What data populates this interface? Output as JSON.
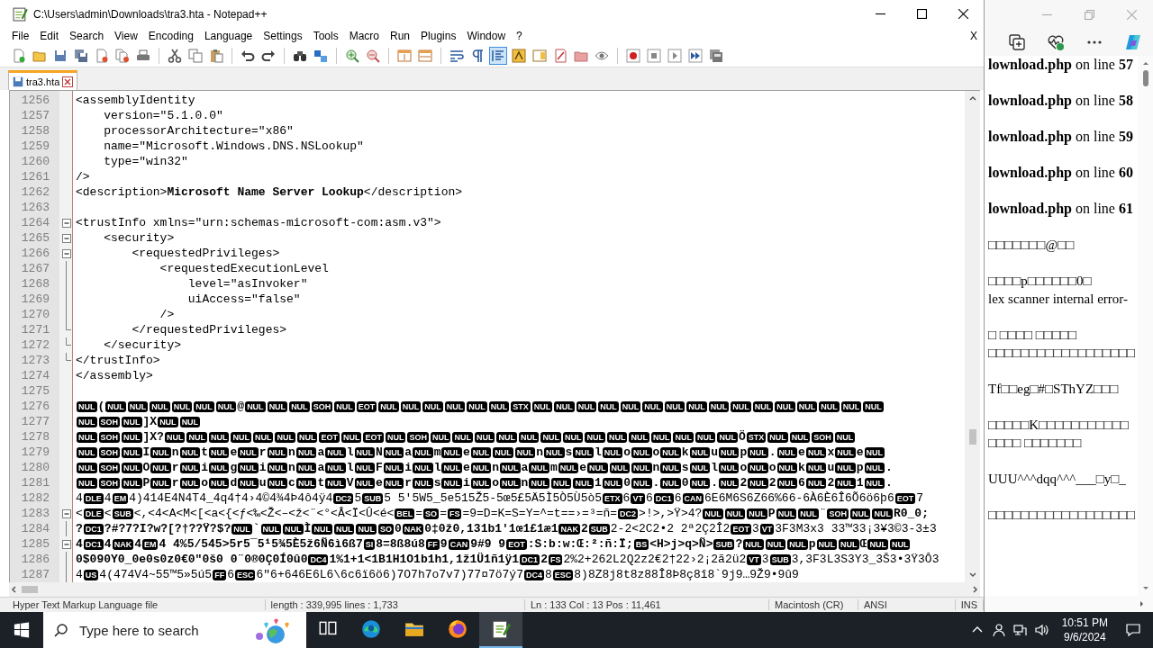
{
  "window": {
    "title": "C:\\Users\\admin\\Downloads\\tra3.hta - Notepad++"
  },
  "menu": [
    "File",
    "Edit",
    "Search",
    "View",
    "Encoding",
    "Language",
    "Settings",
    "Tools",
    "Macro",
    "Run",
    "Plugins",
    "Window",
    "?"
  ],
  "close_document": "X",
  "toolbar": [
    {
      "on": false
    },
    {
      "on": false
    },
    {
      "on": false
    },
    {
      "on": false
    },
    {
      "on": false
    },
    {
      "on": false
    },
    {
      "on": false
    },
    {
      "on": false
    },
    {
      "on": false
    },
    {
      "on": false
    },
    {
      "on": false
    },
    {
      "on": false
    },
    {
      "on": false
    },
    {
      "on": false
    },
    {
      "on": false
    },
    {
      "on": false
    },
    {
      "on": false
    },
    {
      "on": false
    },
    {
      "on": false
    },
    {
      "on": false
    },
    {
      "on": true
    },
    {
      "on": false
    },
    {
      "on": false
    },
    {
      "on": false
    },
    {
      "on": false
    },
    {
      "on": false
    },
    {
      "on": false
    },
    {
      "on": false
    },
    {
      "on": false
    },
    {
      "on": false
    },
    {
      "on": false
    }
  ],
  "tabs": [
    {
      "label": "tra3.hta",
      "selected": true
    }
  ],
  "editor": {
    "lines": [
      {
        "number": "1256",
        "segments": [
          {
            "kind": "plain",
            "text": "<assemblyIdentity"
          }
        ]
      },
      {
        "number": "1257",
        "segments": [
          {
            "kind": "plain",
            "text": "    version=\"5.1.0.0\""
          }
        ]
      },
      {
        "number": "1258",
        "segments": [
          {
            "kind": "plain",
            "text": "    processorArchitecture=\"x86\""
          }
        ]
      },
      {
        "number": "1259",
        "segments": [
          {
            "kind": "plain",
            "text": "    name=\"Microsoft.Windows.DNS.NSLookup\""
          }
        ]
      },
      {
        "number": "1260",
        "segments": [
          {
            "kind": "plain",
            "text": "    type=\"win32\""
          }
        ]
      },
      {
        "number": "1261",
        "segments": [
          {
            "kind": "plain",
            "text": "/>"
          }
        ]
      },
      {
        "number": "1262",
        "segments": [
          {
            "kind": "plain",
            "text": "<description>"
          },
          {
            "kind": "bold",
            "text": "Microsoft Name Server Lookup"
          },
          {
            "kind": "plain",
            "text": "</description>"
          }
        ]
      },
      {
        "number": "1263"
      },
      {
        "number": "1264",
        "kind": "foldstart",
        "segments": [
          {
            "kind": "plain",
            "text": "<trustInfo xmlns=\"urn:schemas-microsoft-com:asm.v3\">"
          }
        ]
      },
      {
        "number": "1265",
        "kind": "foldstart",
        "segments": [
          {
            "kind": "plain",
            "text": "    <security>"
          }
        ]
      },
      {
        "number": "1266",
        "kind": "foldstart",
        "segments": [
          {
            "kind": "plain",
            "text": "        <requestedPrivileges>"
          }
        ]
      },
      {
        "number": "1267",
        "kind": "foldline",
        "segments": [
          {
            "kind": "plain",
            "text": "            <requestedExecutionLevel"
          }
        ]
      },
      {
        "number": "1268",
        "kind": "foldline",
        "segments": [
          {
            "kind": "plain",
            "text": "                level=\"asInvoker\""
          }
        ]
      },
      {
        "number": "1269",
        "kind": "foldline",
        "segments": [
          {
            "kind": "plain",
            "text": "                uiAccess=\"false\""
          }
        ]
      },
      {
        "number": "1270",
        "kind": "foldline",
        "segments": [
          {
            "kind": "plain",
            "text": "            />"
          }
        ]
      },
      {
        "number": "1271",
        "kind": "foldend",
        "segments": [
          {
            "kind": "plain",
            "text": "        </requestedPrivileges>"
          }
        ]
      },
      {
        "number": "1272",
        "kind": "foldend",
        "segments": [
          {
            "kind": "plain",
            "text": "    </security>"
          }
        ]
      },
      {
        "number": "1273",
        "kind": "foldend",
        "segments": [
          {
            "kind": "plain",
            "text": "</trustInfo>"
          }
        ]
      },
      {
        "number": "1274",
        "segments": [
          {
            "kind": "plain",
            "text": "</assembly>"
          }
        ]
      },
      {
        "number": "1275"
      },
      {
        "number": "1276",
        "segments": [
          {
            "kind": "ctrl",
            "text": "NUL"
          },
          {
            "kind": "bold",
            "text": "("
          },
          {
            "kind": "ctrl",
            "text": "NUL"
          },
          {
            "kind": "ctrl",
            "text": "NUL"
          },
          {
            "kind": "ctrl",
            "text": "NUL"
          },
          {
            "kind": "ctrl",
            "text": "NUL"
          },
          {
            "kind": "ctrl",
            "text": "NUL"
          },
          {
            "kind": "ctrl",
            "text": "NUL"
          },
          {
            "kind": "bold",
            "text": "@"
          },
          {
            "kind": "ctrl",
            "text": "NUL"
          },
          {
            "kind": "ctrl",
            "text": "NUL"
          },
          {
            "kind": "ctrl",
            "text": "NUL"
          },
          {
            "kind": "ctrl",
            "text": "SOH"
          },
          {
            "kind": "ctrl",
            "text": "NUL"
          },
          {
            "kind": "ctrl",
            "text": "EOT"
          },
          {
            "kind": "ctrl",
            "text": "NUL"
          },
          {
            "kind": "ctrl",
            "text": "NUL"
          },
          {
            "kind": "ctrl",
            "text": "NUL"
          },
          {
            "kind": "ctrl",
            "text": "NUL"
          },
          {
            "kind": "ctrl",
            "text": "NUL"
          },
          {
            "kind": "ctrl",
            "text": "NUL"
          },
          {
            "kind": "ctrl",
            "text": "STX"
          },
          {
            "kind": "ctrl",
            "text": "NUL"
          },
          {
            "kind": "ctrl",
            "text": "NUL"
          },
          {
            "kind": "ctrl",
            "text": "NUL"
          },
          {
            "kind": "ctrl",
            "text": "NUL"
          },
          {
            "kind": "ctrl",
            "text": "NUL"
          },
          {
            "kind": "ctrl",
            "text": "NUL"
          },
          {
            "kind": "ctrl",
            "text": "NUL"
          },
          {
            "kind": "ctrl",
            "text": "NUL"
          },
          {
            "kind": "ctrl",
            "text": "NUL"
          },
          {
            "kind": "ctrl",
            "text": "NUL"
          },
          {
            "kind": "ctrl",
            "text": "NUL"
          },
          {
            "kind": "ctrl",
            "text": "NUL"
          },
          {
            "kind": "ctrl",
            "text": "NUL"
          },
          {
            "kind": "ctrl",
            "text": "NUL"
          },
          {
            "kind": "ctrl",
            "text": "NUL"
          },
          {
            "kind": "ctrl",
            "text": "NUL"
          }
        ]
      },
      {
        "number": "1277",
        "segments": [
          {
            "kind": "ctrl",
            "text": "NUL"
          },
          {
            "kind": "ctrl",
            "text": "SOH"
          },
          {
            "kind": "ctrl",
            "text": "NUL"
          },
          {
            "kind": "bold",
            "text": "]X"
          },
          {
            "kind": "ctrl",
            "text": "NUL"
          },
          {
            "kind": "ctrl",
            "text": "NUL"
          }
        ]
      },
      {
        "number": "1278",
        "segments": [
          {
            "kind": "ctrl",
            "text": "NUL"
          },
          {
            "kind": "ctrl",
            "text": "SOH"
          },
          {
            "kind": "ctrl",
            "text": "NUL"
          },
          {
            "kind": "bold",
            "text": "]X?"
          },
          {
            "kind": "ctrl",
            "text": "NUL"
          },
          {
            "kind": "ctrl",
            "text": "NUL"
          },
          {
            "kind": "ctrl",
            "text": "NUL"
          },
          {
            "kind": "ctrl",
            "text": "NUL"
          },
          {
            "kind": "ctrl",
            "text": "NUL"
          },
          {
            "kind": "ctrl",
            "text": "NUL"
          },
          {
            "kind": "ctrl",
            "text": "NUL"
          },
          {
            "kind": "ctrl",
            "text": "EOT"
          },
          {
            "kind": "ctrl",
            "text": "NUL"
          },
          {
            "kind": "ctrl",
            "text": "EOT"
          },
          {
            "kind": "ctrl",
            "text": "NUL"
          },
          {
            "kind": "ctrl",
            "text": "SOH"
          },
          {
            "kind": "ctrl",
            "text": "NUL"
          },
          {
            "kind": "ctrl",
            "text": "NUL"
          },
          {
            "kind": "ctrl",
            "text": "NUL"
          },
          {
            "kind": "ctrl",
            "text": "NUL"
          },
          {
            "kind": "ctrl",
            "text": "NUL"
          },
          {
            "kind": "ctrl",
            "text": "NUL"
          },
          {
            "kind": "ctrl",
            "text": "NUL"
          },
          {
            "kind": "ctrl",
            "text": "NUL"
          },
          {
            "kind": "ctrl",
            "text": "NUL"
          },
          {
            "kind": "ctrl",
            "text": "NUL"
          },
          {
            "kind": "ctrl",
            "text": "NUL"
          },
          {
            "kind": "ctrl",
            "text": "NUL"
          },
          {
            "kind": "ctrl",
            "text": "NUL"
          },
          {
            "kind": "ctrl",
            "text": "NUL"
          },
          {
            "kind": "bold",
            "text": "Ö"
          },
          {
            "kind": "ctrl",
            "text": "STX"
          },
          {
            "kind": "ctrl",
            "text": "NUL"
          },
          {
            "kind": "ctrl",
            "text": "NUL"
          },
          {
            "kind": "ctrl",
            "text": "SOH"
          },
          {
            "kind": "ctrl",
            "text": "NUL"
          }
        ]
      },
      {
        "number": "1279",
        "segments": [
          {
            "kind": "ctrl",
            "text": "NUL"
          },
          {
            "kind": "ctrl",
            "text": "SOH"
          },
          {
            "kind": "ctrl",
            "text": "NUL"
          },
          {
            "kind": "bold",
            "text": "I"
          },
          {
            "kind": "ctrl",
            "text": "NUL"
          },
          {
            "kind": "bold",
            "text": "n"
          },
          {
            "kind": "ctrl",
            "text": "NUL"
          },
          {
            "kind": "bold",
            "text": "t"
          },
          {
            "kind": "ctrl",
            "text": "NUL"
          },
          {
            "kind": "bold",
            "text": "e"
          },
          {
            "kind": "ctrl",
            "text": "NUL"
          },
          {
            "kind": "bold",
            "text": "r"
          },
          {
            "kind": "ctrl",
            "text": "NUL"
          },
          {
            "kind": "bold",
            "text": "n"
          },
          {
            "kind": "ctrl",
            "text": "NUL"
          },
          {
            "kind": "bold",
            "text": "a"
          },
          {
            "kind": "ctrl",
            "text": "NUL"
          },
          {
            "kind": "bold",
            "text": "l"
          },
          {
            "kind": "ctrl",
            "text": "NUL"
          },
          {
            "kind": "bold",
            "text": "N"
          },
          {
            "kind": "ctrl",
            "text": "NUL"
          },
          {
            "kind": "bold",
            "text": "a"
          },
          {
            "kind": "ctrl",
            "text": "NUL"
          },
          {
            "kind": "bold",
            "text": "m"
          },
          {
            "kind": "ctrl",
            "text": "NUL"
          },
          {
            "kind": "bold",
            "text": "e"
          },
          {
            "kind": "ctrl",
            "text": "NUL"
          },
          {
            "kind": "ctrl",
            "text": "NUL"
          },
          {
            "kind": "ctrl",
            "text": "NUL"
          },
          {
            "kind": "bold",
            "text": "n"
          },
          {
            "kind": "ctrl",
            "text": "NUL"
          },
          {
            "kind": "bold",
            "text": "s"
          },
          {
            "kind": "ctrl",
            "text": "NUL"
          },
          {
            "kind": "bold",
            "text": "l"
          },
          {
            "kind": "ctrl",
            "text": "NUL"
          },
          {
            "kind": "bold",
            "text": "o"
          },
          {
            "kind": "ctrl",
            "text": "NUL"
          },
          {
            "kind": "bold",
            "text": "o"
          },
          {
            "kind": "ctrl",
            "text": "NUL"
          },
          {
            "kind": "bold",
            "text": "k"
          },
          {
            "kind": "ctrl",
            "text": "NUL"
          },
          {
            "kind": "bold",
            "text": "u"
          },
          {
            "kind": "ctrl",
            "text": "NUL"
          },
          {
            "kind": "bold",
            "text": "p"
          },
          {
            "kind": "ctrl",
            "text": "NUL"
          },
          {
            "kind": "bold",
            "text": "."
          },
          {
            "kind": "ctrl",
            "text": "NUL"
          },
          {
            "kind": "bold",
            "text": "e"
          },
          {
            "kind": "ctrl",
            "text": "NUL"
          },
          {
            "kind": "bold",
            "text": "x"
          },
          {
            "kind": "ctrl",
            "text": "NUL"
          },
          {
            "kind": "bold",
            "text": "e"
          },
          {
            "kind": "ctrl",
            "text": "NUL"
          }
        ]
      },
      {
        "number": "1280",
        "segments": [
          {
            "kind": "ctrl",
            "text": "NUL"
          },
          {
            "kind": "ctrl",
            "text": "SOH"
          },
          {
            "kind": "ctrl",
            "text": "NUL"
          },
          {
            "kind": "bold",
            "text": "O"
          },
          {
            "kind": "ctrl",
            "text": "NUL"
          },
          {
            "kind": "bold",
            "text": "r"
          },
          {
            "kind": "ctrl",
            "text": "NUL"
          },
          {
            "kind": "bold",
            "text": "i"
          },
          {
            "kind": "ctrl",
            "text": "NUL"
          },
          {
            "kind": "bold",
            "text": "g"
          },
          {
            "kind": "ctrl",
            "text": "NUL"
          },
          {
            "kind": "bold",
            "text": "i"
          },
          {
            "kind": "ctrl",
            "text": "NUL"
          },
          {
            "kind": "bold",
            "text": "n"
          },
          {
            "kind": "ctrl",
            "text": "NUL"
          },
          {
            "kind": "bold",
            "text": "a"
          },
          {
            "kind": "ctrl",
            "text": "NUL"
          },
          {
            "kind": "bold",
            "text": "l"
          },
          {
            "kind": "ctrl",
            "text": "NUL"
          },
          {
            "kind": "bold",
            "text": "F"
          },
          {
            "kind": "ctrl",
            "text": "NUL"
          },
          {
            "kind": "bold",
            "text": "i"
          },
          {
            "kind": "ctrl",
            "text": "NUL"
          },
          {
            "kind": "bold",
            "text": "l"
          },
          {
            "kind": "ctrl",
            "text": "NUL"
          },
          {
            "kind": "bold",
            "text": "e"
          },
          {
            "kind": "ctrl",
            "text": "NUL"
          },
          {
            "kind": "bold",
            "text": "n"
          },
          {
            "kind": "ctrl",
            "text": "NUL"
          },
          {
            "kind": "bold",
            "text": "a"
          },
          {
            "kind": "ctrl",
            "text": "NUL"
          },
          {
            "kind": "bold",
            "text": "m"
          },
          {
            "kind": "ctrl",
            "text": "NUL"
          },
          {
            "kind": "bold",
            "text": "e"
          },
          {
            "kind": "ctrl",
            "text": "NUL"
          },
          {
            "kind": "ctrl",
            "text": "NUL"
          },
          {
            "kind": "ctrl",
            "text": "NUL"
          },
          {
            "kind": "bold",
            "text": "n"
          },
          {
            "kind": "ctrl",
            "text": "NUL"
          },
          {
            "kind": "bold",
            "text": "s"
          },
          {
            "kind": "ctrl",
            "text": "NUL"
          },
          {
            "kind": "bold",
            "text": "l"
          },
          {
            "kind": "ctrl",
            "text": "NUL"
          },
          {
            "kind": "bold",
            "text": "o"
          },
          {
            "kind": "ctrl",
            "text": "NUL"
          },
          {
            "kind": "bold",
            "text": "o"
          },
          {
            "kind": "ctrl",
            "text": "NUL"
          },
          {
            "kind": "bold",
            "text": "k"
          },
          {
            "kind": "ctrl",
            "text": "NUL"
          },
          {
            "kind": "bold",
            "text": "u"
          },
          {
            "kind": "ctrl",
            "text": "NUL"
          },
          {
            "kind": "bold",
            "text": "p"
          },
          {
            "kind": "ctrl",
            "text": "NUL"
          },
          {
            "kind": "bold",
            "text": "."
          }
        ]
      },
      {
        "number": "1281",
        "segments": [
          {
            "kind": "ctrl",
            "text": "NUL"
          },
          {
            "kind": "ctrl",
            "text": "SOH"
          },
          {
            "kind": "ctrl",
            "text": "NUL"
          },
          {
            "kind": "bold",
            "text": "P"
          },
          {
            "kind": "ctrl",
            "text": "NUL"
          },
          {
            "kind": "bold",
            "text": "r"
          },
          {
            "kind": "ctrl",
            "text": "NUL"
          },
          {
            "kind": "bold",
            "text": "o"
          },
          {
            "kind": "ctrl",
            "text": "NUL"
          },
          {
            "kind": "bold",
            "text": "d"
          },
          {
            "kind": "ctrl",
            "text": "NUL"
          },
          {
            "kind": "bold",
            "text": "u"
          },
          {
            "kind": "ctrl",
            "text": "NUL"
          },
          {
            "kind": "bold",
            "text": "c"
          },
          {
            "kind": "ctrl",
            "text": "NUL"
          },
          {
            "kind": "bold",
            "text": "t"
          },
          {
            "kind": "ctrl",
            "text": "NUL"
          },
          {
            "kind": "bold",
            "text": "V"
          },
          {
            "kind": "ctrl",
            "text": "NUL"
          },
          {
            "kind": "bold",
            "text": "e"
          },
          {
            "kind": "ctrl",
            "text": "NUL"
          },
          {
            "kind": "bold",
            "text": "r"
          },
          {
            "kind": "ctrl",
            "text": "NUL"
          },
          {
            "kind": "bold",
            "text": "s"
          },
          {
            "kind": "ctrl",
            "text": "NUL"
          },
          {
            "kind": "bold",
            "text": "i"
          },
          {
            "kind": "ctrl",
            "text": "NUL"
          },
          {
            "kind": "bold",
            "text": "o"
          },
          {
            "kind": "ctrl",
            "text": "NUL"
          },
          {
            "kind": "bold",
            "text": "n"
          },
          {
            "kind": "ctrl",
            "text": "NUL"
          },
          {
            "kind": "ctrl",
            "text": "NUL"
          },
          {
            "kind": "ctrl",
            "text": "NUL"
          },
          {
            "kind": "bold",
            "text": "1"
          },
          {
            "kind": "ctrl",
            "text": "NUL"
          },
          {
            "kind": "bold",
            "text": "0"
          },
          {
            "kind": "ctrl",
            "text": "NUL"
          },
          {
            "kind": "bold",
            "text": "."
          },
          {
            "kind": "ctrl",
            "text": "NUL"
          },
          {
            "kind": "bold",
            "text": "0"
          },
          {
            "kind": "ctrl",
            "text": "NUL"
          },
          {
            "kind": "bold",
            "text": "."
          },
          {
            "kind": "ctrl",
            "text": "NUL"
          },
          {
            "kind": "bold",
            "text": "2"
          },
          {
            "kind": "ctrl",
            "text": "NUL"
          },
          {
            "kind": "bold",
            "text": "2"
          },
          {
            "kind": "ctrl",
            "text": "NUL"
          },
          {
            "kind": "bold",
            "text": "6"
          },
          {
            "kind": "ctrl",
            "text": "NUL"
          },
          {
            "kind": "bold",
            "text": "2"
          },
          {
            "kind": "ctrl",
            "text": "NUL"
          },
          {
            "kind": "bold",
            "text": "1"
          },
          {
            "kind": "ctrl",
            "text": "NUL"
          },
          {
            "kind": "bold",
            "text": "."
          }
        ]
      },
      {
        "number": "1282",
        "segments": [
          {
            "kind": "plain",
            "text": "4"
          },
          {
            "kind": "ctrl",
            "text": "DLE"
          },
          {
            "kind": "plain",
            "text": "4"
          },
          {
            "kind": "ctrl",
            "text": "EM"
          },
          {
            "kind": "plain",
            "text": "4)414E4N4T4_4q4†4›4©4¾4Þ4ô4ÿ4"
          },
          {
            "kind": "ctrl",
            "text": "DC2"
          },
          {
            "kind": "plain",
            "text": "5"
          },
          {
            "kind": "ctrl",
            "text": "SUB"
          },
          {
            "kind": "plain",
            "text": "5 5'5W5_5e515Ž5-5œ5£5Ä5Ì5Ò5Ù5ò5"
          },
          {
            "kind": "ctrl",
            "text": "ETX"
          },
          {
            "kind": "plain",
            "text": "6"
          },
          {
            "kind": "ctrl",
            "text": "VT"
          },
          {
            "kind": "plain",
            "text": "6"
          },
          {
            "kind": "ctrl",
            "text": "DC1"
          },
          {
            "kind": "plain",
            "text": "6"
          },
          {
            "kind": "ctrl",
            "text": "CAN"
          },
          {
            "kind": "plain",
            "text": "6E6M6S6Z66%66-6À6È6Î6Õ6ö6þ6"
          },
          {
            "kind": "ctrl",
            "text": "EOT"
          },
          {
            "kind": "plain",
            "text": "7"
          }
        ]
      },
      {
        "number": "1283",
        "kind": "foldstart",
        "segments": [
          {
            "kind": "plain",
            "text": "<"
          },
          {
            "kind": "ctrl",
            "text": "DLE"
          },
          {
            "kind": "plain",
            "text": "<"
          },
          {
            "kind": "ctrl",
            "text": "SUB"
          },
          {
            "kind": "plain",
            "text": "<,<4<A<M<[<a<{<ƒ<‰<Ž<–<ž<¨<°<Â<Ï<Û<é<"
          },
          {
            "kind": "ctrl",
            "text": "BEL"
          },
          {
            "kind": "plain",
            "text": "="
          },
          {
            "kind": "ctrl",
            "text": "SO"
          },
          {
            "kind": "plain",
            "text": "="
          },
          {
            "kind": "ctrl",
            "text": "FS"
          },
          {
            "kind": "plain",
            "text": "=9=D=K=S=Y=^=t==›=³=ñ="
          },
          {
            "kind": "ctrl",
            "text": "DC2"
          },
          {
            "kind": "plain",
            "text": ">!>,>Ÿ>4?"
          },
          {
            "kind": "ctrl",
            "text": "NUL"
          },
          {
            "kind": "ctrl",
            "text": "NUL"
          },
          {
            "kind": "ctrl",
            "text": "NUL"
          },
          {
            "kind": "bold",
            "text": "P"
          },
          {
            "kind": "ctrl",
            "text": "NUL"
          },
          {
            "kind": "ctrl",
            "text": "NUL"
          },
          {
            "kind": "plain",
            "text": "¨"
          },
          {
            "kind": "ctrl",
            "text": "SOH"
          },
          {
            "kind": "ctrl",
            "text": "NUL"
          },
          {
            "kind": "ctrl",
            "text": "NUL"
          },
          {
            "kind": "bold",
            "text": "R0_0;"
          }
        ]
      },
      {
        "number": "1284",
        "kind": "foldline",
        "segments": [
          {
            "kind": "bold",
            "text": "?"
          },
          {
            "kind": "ctrl",
            "text": "DC1"
          },
          {
            "kind": "bold",
            "text": "?#?7?I?w?[?†??Ÿ?$?"
          },
          {
            "kind": "ctrl",
            "text": "NUL"
          },
          {
            "kind": "bold",
            "text": "`"
          },
          {
            "kind": "ctrl",
            "text": "NUL"
          },
          {
            "kind": "ctrl",
            "text": "NUL"
          },
          {
            "kind": "bold",
            "text": "Ì"
          },
          {
            "kind": "ctrl",
            "text": "NUL"
          },
          {
            "kind": "ctrl",
            "text": "NUL"
          },
          {
            "kind": "ctrl",
            "text": "NUL"
          },
          {
            "kind": "ctrl",
            "text": "SO"
          },
          {
            "kind": "bold",
            "text": "0"
          },
          {
            "kind": "ctrl",
            "text": "NAK"
          },
          {
            "kind": "bold",
            "text": "0‡0ž0,131b1'1œ1£1æ1"
          },
          {
            "kind": "ctrl",
            "text": "NAK"
          },
          {
            "kind": "bold",
            "text": "2"
          },
          {
            "kind": "ctrl",
            "text": "SUB"
          },
          {
            "kind": "plain",
            "text": "2-2<2C2•2 2ª2Ç2Î2"
          },
          {
            "kind": "ctrl",
            "text": "EOT"
          },
          {
            "kind": "plain",
            "text": "3"
          },
          {
            "kind": "ctrl",
            "text": "VT"
          },
          {
            "kind": "plain",
            "text": "3F3M3x3 33™33¡3¥3©3-3±3"
          }
        ]
      },
      {
        "number": "1285",
        "kind": "foldstart",
        "segments": [
          {
            "kind": "bold",
            "text": "4"
          },
          {
            "kind": "ctrl",
            "text": "DC1"
          },
          {
            "kind": "bold",
            "text": "4"
          },
          {
            "kind": "ctrl",
            "text": "NAK"
          },
          {
            "kind": "bold",
            "text": "4"
          },
          {
            "kind": "ctrl",
            "text": "EM"
          },
          {
            "kind": "bold",
            "text": "4 4%5/545>5r5¯5¹5¾5È5ž6Ñ6ì6ß7"
          },
          {
            "kind": "ctrl",
            "text": "SI"
          },
          {
            "kind": "bold",
            "text": "8=8ß8ú8"
          },
          {
            "kind": "ctrl",
            "text": "FF"
          },
          {
            "kind": "bold",
            "text": "9"
          },
          {
            "kind": "ctrl",
            "text": "CAN"
          },
          {
            "kind": "bold",
            "text": "9#9 9"
          },
          {
            "kind": "ctrl",
            "text": "EOT"
          },
          {
            "kind": "bold",
            "text": ":S:b:w:Œ:²:ñ:Ï;"
          },
          {
            "kind": "ctrl",
            "text": "BS"
          },
          {
            "kind": "bold",
            "text": "<H>j>q>Ñ>"
          },
          {
            "kind": "ctrl",
            "text": "SUB"
          },
          {
            "kind": "bold",
            "text": "?"
          },
          {
            "kind": "ctrl",
            "text": "NUL"
          },
          {
            "kind": "ctrl",
            "text": "NUL"
          },
          {
            "kind": "ctrl",
            "text": "NUL"
          },
          {
            "kind": "bold",
            "text": "p"
          },
          {
            "kind": "ctrl",
            "text": "NUL"
          },
          {
            "kind": "ctrl",
            "text": "NUL"
          },
          {
            "kind": "bold",
            "text": "Œ"
          },
          {
            "kind": "ctrl",
            "text": "NUL"
          },
          {
            "kind": "ctrl",
            "text": "NUL"
          }
        ]
      },
      {
        "number": "1286",
        "kind": "foldline",
        "segments": [
          {
            "kind": "bold",
            "text": "0$090Y0_0e0s0z0€0″0š0 0¨0®0Ç0Í0û0"
          },
          {
            "kind": "ctrl",
            "text": "DC4"
          },
          {
            "kind": "bold",
            "text": "1%1+1<1B1H1O1b1h1,1ž1Ü1ñ1ÿ1"
          },
          {
            "kind": "ctrl",
            "text": "DC1"
          },
          {
            "kind": "bold",
            "text": "2"
          },
          {
            "kind": "ctrl",
            "text": "FS"
          },
          {
            "kind": "plain",
            "text": "2%2+262L2Q2z2€2†22›2¡2ã2ü2"
          },
          {
            "kind": "ctrl",
            "text": "VT"
          },
          {
            "kind": "plain",
            "text": "3"
          },
          {
            "kind": "ctrl",
            "text": "SUB"
          },
          {
            "kind": "plain",
            "text": "3,3F3L3S3Y3_3Š3•3Ÿ3Ô3"
          }
        ]
      },
      {
        "number": "1287",
        "kind": "foldline",
        "segments": [
          {
            "kind": "plain",
            "text": "4"
          },
          {
            "kind": "ctrl",
            "text": "US"
          },
          {
            "kind": "plain",
            "text": "4(474V4~55™5»5ú5"
          },
          {
            "kind": "ctrl",
            "text": "FF"
          },
          {
            "kind": "plain",
            "text": "6"
          },
          {
            "kind": "ctrl",
            "text": "ESC"
          },
          {
            "kind": "plain",
            "text": "6″6+646E6L6\\6c6ï6ö6)7O7h7o7v7)77¤7ö7ý7"
          },
          {
            "kind": "ctrl",
            "text": "DC4"
          },
          {
            "kind": "plain",
            "text": "8"
          },
          {
            "kind": "ctrl",
            "text": "ESC"
          },
          {
            "kind": "plain",
            "text": "8)8Z8j8t8z88Î8Þ8ç8î8`9j9…9Ž9•9û9"
          }
        ]
      }
    ]
  },
  "status_bar": [
    "Hyper Text Markup Language file",
    "length : 339,995    lines : 1,733",
    "Ln : 133    Col : 13    Pos : 11,461",
    "Macintosh (CR)",
    "ANSI",
    "INS"
  ],
  "browser": {
    "items": [
      {
        "kind": "error",
        "text": "**lownload.php** on line **57**"
      },
      {
        "kind": "error",
        "text": "**lownload.php** on line **58**"
      },
      {
        "kind": "error",
        "text": "**lownload.php** on line **59**"
      },
      {
        "kind": "error",
        "text": "**lownload.php** on line **60**"
      },
      {
        "kind": "error",
        "text": "**lownload.php** on line **61**"
      },
      {
        "kind": "text",
        "lines": [
          "□□□□□□□@□□"
        ]
      },
      {
        "kind": "text",
        "lines": [
          "□□□□p□□□□□□0□",
          "lex scanner internal error-"
        ]
      },
      {
        "kind": "text",
        "lines": [
          "□ □□□□ □□□□□",
          "□□□□□□□□□□□□□□□□□□"
        ]
      },
      {
        "kind": "text",
        "lines": [
          "Tf□□eg□#□SThYZ□□□"
        ]
      },
      {
        "kind": "text",
        "lines": [
          "□□□□□K□□□□□□□□□□□",
          "□□□□ □□□□□□□"
        ]
      },
      {
        "kind": "text",
        "lines": [
          "UUU^^^dqq^^^___□y□_"
        ]
      },
      {
        "kind": "text",
        "lines": [
          "□□□□□□□□□□□□□□□□□□"
        ]
      }
    ]
  },
  "taskbar": {
    "search": {
      "placeholder": "Type here to search"
    },
    "apps": [
      {
        "selected": false
      },
      {
        "selected": false
      },
      {
        "selected": false
      },
      {
        "selected": false
      },
      {
        "selected": true
      }
    ],
    "time": "10:51 PM",
    "date": "9/6/2024"
  }
}
